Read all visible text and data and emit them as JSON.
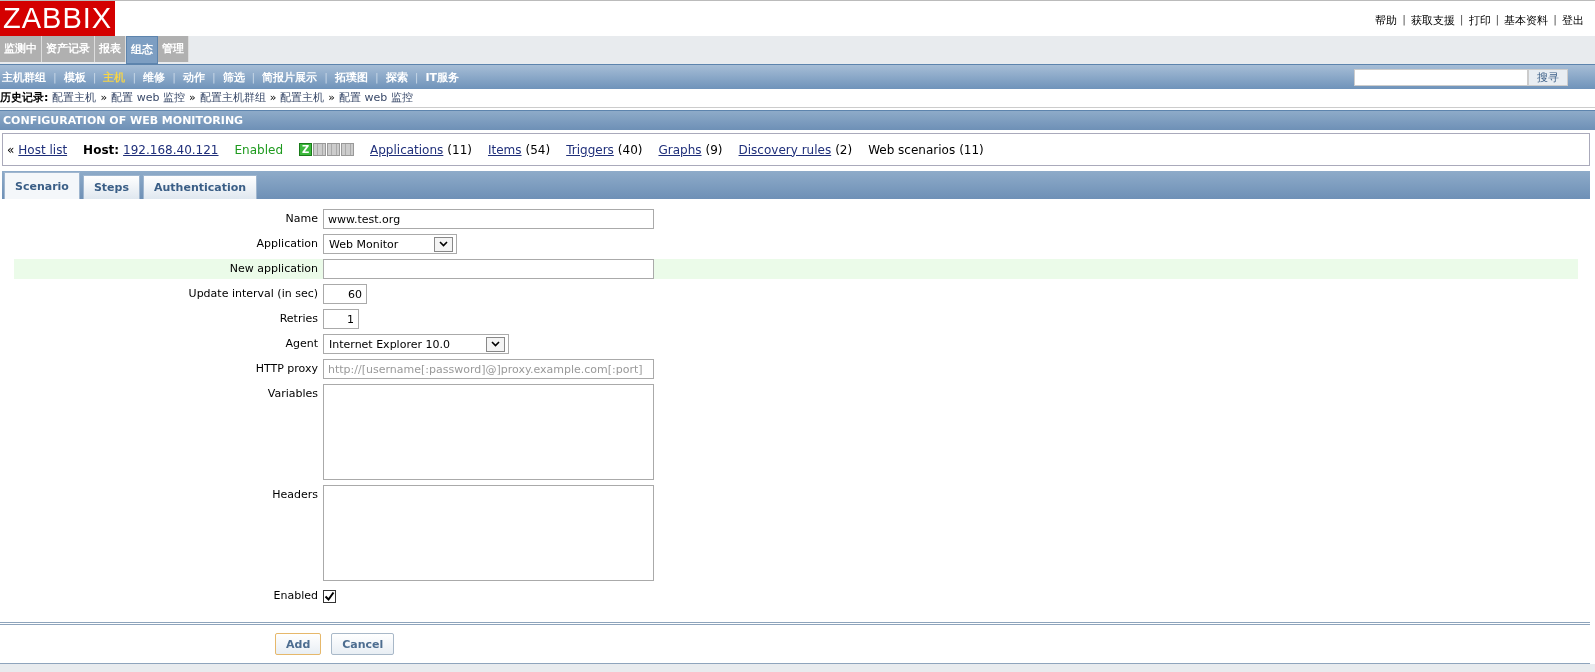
{
  "logo": "ZABBIX",
  "top_links": {
    "separator": "|",
    "items": [
      "帮助",
      "获取支援",
      "打印",
      "基本资料",
      "登出"
    ]
  },
  "sub_menu_separator": "|",
  "main_menu": [
    {
      "label": "监测中",
      "selected": false
    },
    {
      "label": "资产记录",
      "selected": false
    },
    {
      "label": "报表",
      "selected": false
    },
    {
      "label": "组态",
      "selected": true
    },
    {
      "label": "管理",
      "selected": false
    }
  ],
  "sub_menu": [
    {
      "label": "主机群组",
      "selected": false
    },
    {
      "label": "模板",
      "selected": false
    },
    {
      "label": "主机",
      "selected": true
    },
    {
      "label": "维修",
      "selected": false
    },
    {
      "label": "动作",
      "selected": false
    },
    {
      "label": "筛选",
      "selected": false
    },
    {
      "label": "简报片展示",
      "selected": false
    },
    {
      "label": "拓璞图",
      "selected": false
    },
    {
      "label": "探索",
      "selected": false
    },
    {
      "label": "IT服务",
      "selected": false
    }
  ],
  "search": {
    "button": "搜寻"
  },
  "history": {
    "label": "历史记录:",
    "separator": "»",
    "items": [
      "配置主机",
      "配置 web 监控",
      "配置主机群组",
      "配置主机",
      "配置 web 监控"
    ]
  },
  "title": "CONFIGURATION OF WEB MONITORING",
  "host_bar": {
    "back_mark": "«",
    "back": "Host list",
    "host_label": "Host:",
    "host": "192.168.40.121",
    "status": "Enabled",
    "availability": [
      {
        "label": "Z",
        "available": true
      },
      {
        "available": false
      },
      {
        "available": false
      },
      {
        "available": false
      }
    ],
    "links": [
      {
        "label": "Applications",
        "count": "(11)",
        "link": true
      },
      {
        "label": "Items",
        "count": "(54)",
        "link": true
      },
      {
        "label": "Triggers",
        "count": "(40)",
        "link": true
      },
      {
        "label": "Graphs",
        "count": "(9)",
        "link": true
      },
      {
        "label": "Discovery rules",
        "count": "(2)",
        "link": true
      },
      {
        "label": "Web scenarios",
        "count": "(11)",
        "link": false
      }
    ]
  },
  "tabs": [
    {
      "label": "Scenario",
      "selected": true
    },
    {
      "label": "Steps",
      "selected": false
    },
    {
      "label": "Authentication",
      "selected": false
    }
  ],
  "form": [
    {
      "kind": "text",
      "label": "Name",
      "value": "www.test.org",
      "highlighted": false
    },
    {
      "kind": "select",
      "label": "Application",
      "value": "Web Monitor",
      "highlighted": false
    },
    {
      "kind": "text",
      "label": "New application",
      "highlighted": true
    },
    {
      "kind": "number",
      "label": "Update interval (in sec)",
      "value": "60",
      "highlighted": false
    },
    {
      "kind": "number",
      "label": "Retries",
      "value": "1",
      "highlighted": false
    },
    {
      "kind": "select",
      "label": "Agent",
      "value": "Internet Explorer 10.0",
      "highlighted": false
    },
    {
      "kind": "text",
      "label": "HTTP proxy",
      "placeholder": "http://[username[:password]@]proxy.example.com[:port]",
      "highlighted": false
    },
    {
      "kind": "textarea",
      "label": "Variables",
      "highlighted": false
    },
    {
      "kind": "textarea",
      "label": "Headers",
      "highlighted": false
    },
    {
      "kind": "checkbox",
      "label": "Enabled",
      "checked": true,
      "highlighted": false
    }
  ],
  "buttons": [
    {
      "label": "Add",
      "primary": true
    },
    {
      "label": "Cancel",
      "primary": false
    }
  ]
}
